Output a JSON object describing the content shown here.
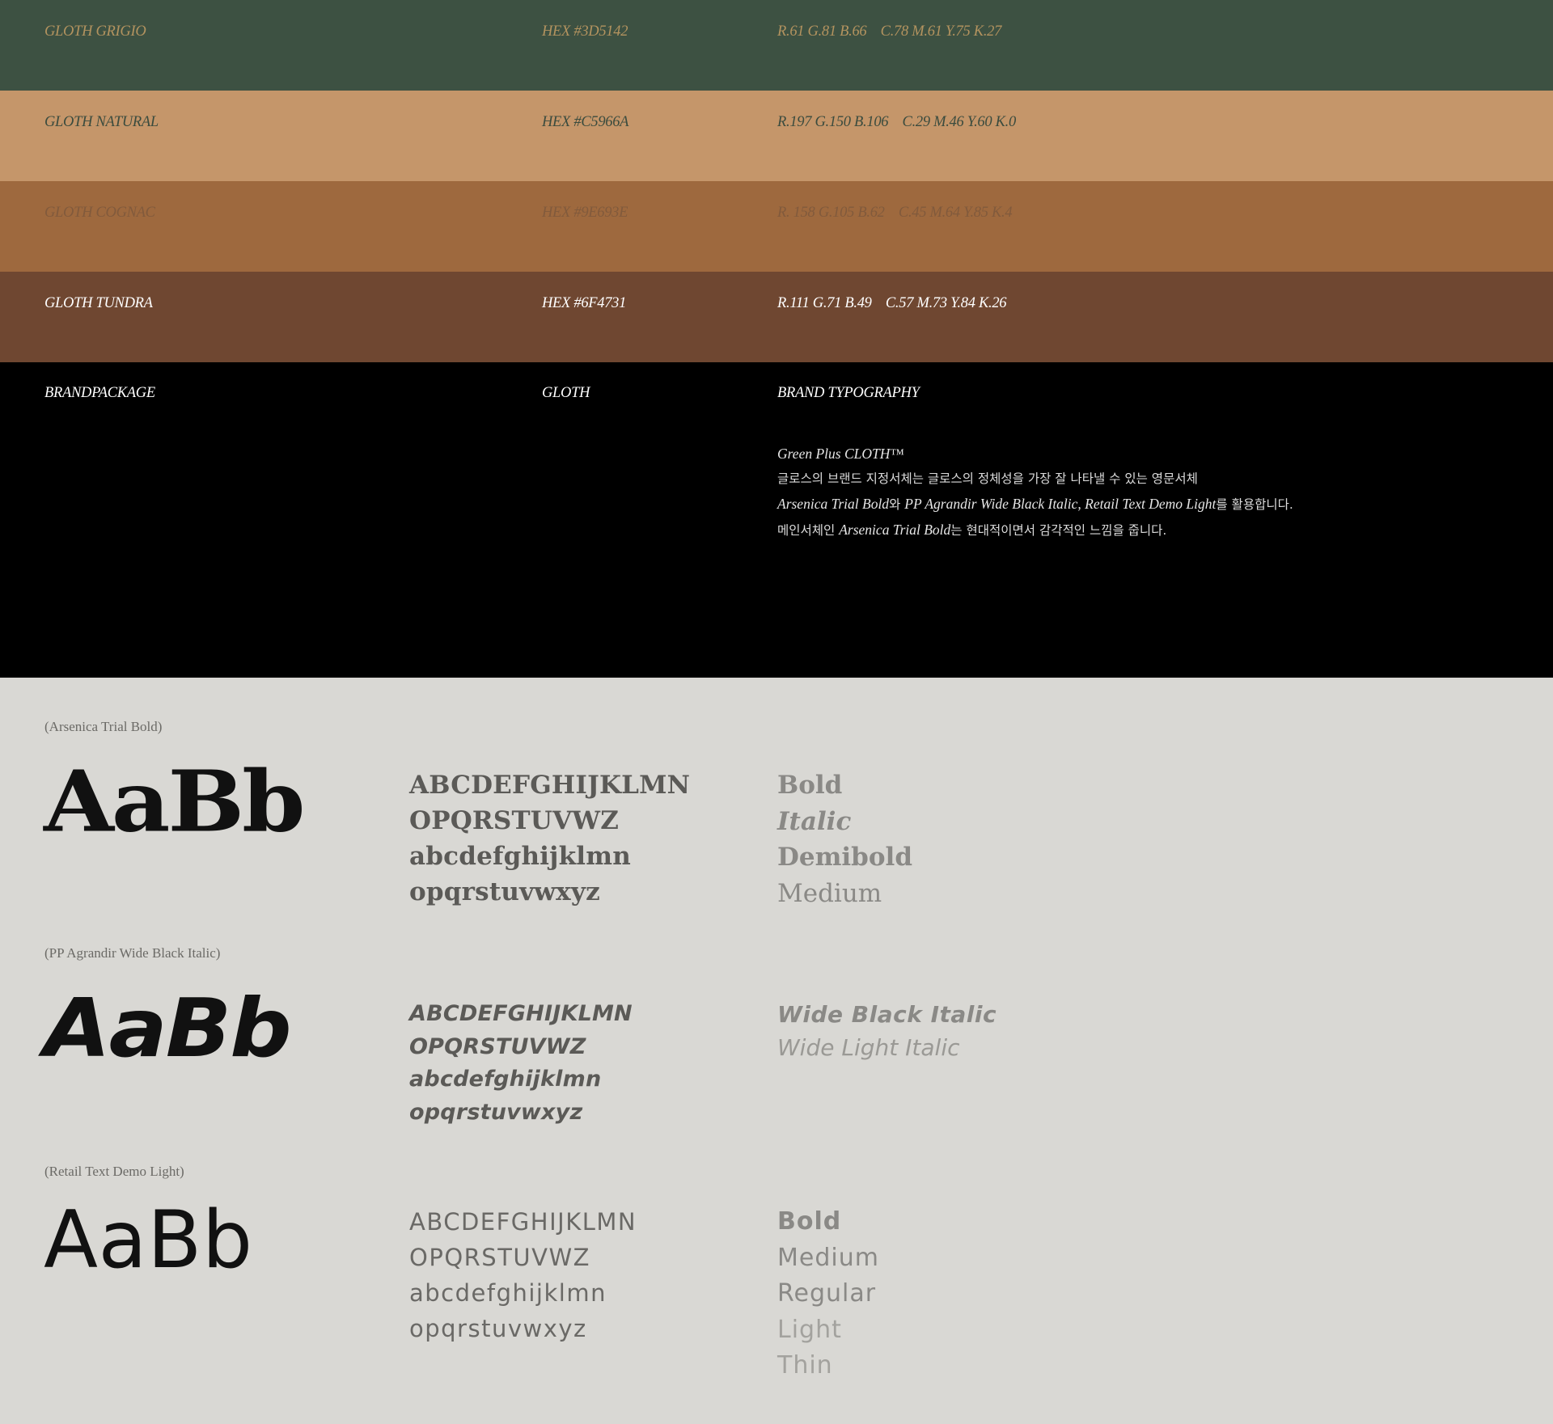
{
  "colors": [
    {
      "name": "GLOTH GRIGIO",
      "hex": "HEX #3D5142",
      "values": "R.61 G.81 B.66    C.78 M.61 Y.75 K.27",
      "swatch": "#3D5142"
    },
    {
      "name": "GLOTH NATURAL",
      "hex": "HEX #C5966A",
      "values": "R.197 G.150 B.106    C.29 M.46 Y.60 K.0",
      "swatch": "#C5966A"
    },
    {
      "name": "GLOTH COGNAC",
      "hex": "HEX #9E693E",
      "values": "R. 158 G.105 B.62    C.45 M.64 Y.85 K.4",
      "swatch": "#9E693E"
    },
    {
      "name": "GLOTH TUNDRA",
      "hex": "HEX #6F4731",
      "values": "R.111 G.71 B.49    C.57 M.73 Y.84 K.26",
      "swatch": "#6F4731"
    }
  ],
  "brand": {
    "col1": "BRANDPACKAGE",
    "col2": "GLOTH",
    "col3": "BRAND TYPOGRAPHY",
    "line1": "Green Plus CLOTH™",
    "line2": "글로스의 브랜드 지정서체는 글로스의 정체성을 가장 잘 나타낼 수 있는 영문서체",
    "line3_en": "Arsenica Trial Bold",
    "line3_ko1": "와 ",
    "line3_en2": "PP Agrandir Wide Black Italic, Retail Text Demo Light",
    "line3_ko2": "를 활용합니다.",
    "line4_ko1": "메인서체인 ",
    "line4_en": "Arsenica Trial Bold",
    "line4_ko2": "는 현대적이면서 감각적인 느낌을 줍니다."
  },
  "fonts": [
    {
      "label": "(Arsenica Trial Bold)",
      "sample": "AaBb",
      "alphabet": [
        "ABCDEFGHIJKLMN",
        "OPQRSTUVWZ",
        "abcdefghijklmn",
        "opqrstuvwxyz"
      ],
      "weights": [
        "Bold",
        "Italic",
        "Demibold",
        "Medium"
      ]
    },
    {
      "label": "(PP Agrandir Wide Black Italic)",
      "sample": "AaBb",
      "alphabet": [
        "ABCDEFGHIJKLMN",
        "OPQRSTUVWZ",
        "abcdefghijklmn",
        "opqrstuvwxyz"
      ],
      "weights": [
        "Wide Black Italic",
        "Wide Light Italic"
      ]
    },
    {
      "label": "(Retail Text Demo Light)",
      "sample": "AaBb",
      "alphabet": [
        "ABCDEFGHIJKLMN",
        "OPQRSTUVWZ",
        "abcdefghijklmn",
        "opqrstuvwxyz"
      ],
      "weights": [
        "Bold",
        "Medium",
        "Regular",
        "Light",
        "Thin"
      ]
    }
  ]
}
